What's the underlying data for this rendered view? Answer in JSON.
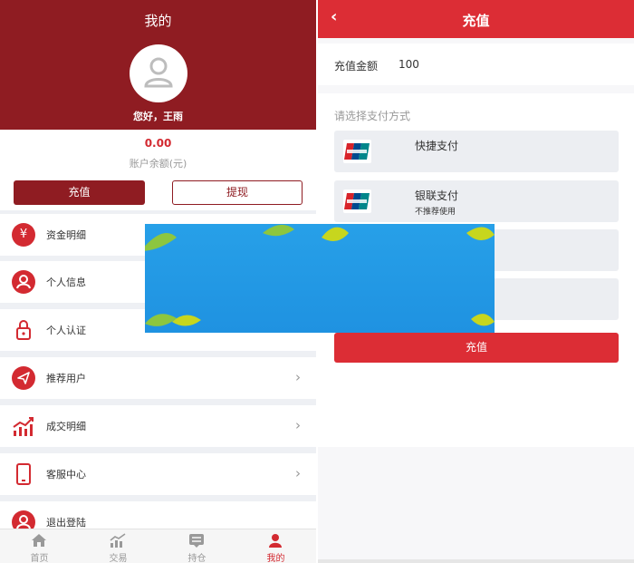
{
  "left": {
    "title": "我的",
    "greeting": "您好，王雨",
    "balance": {
      "value": "0.00",
      "label": "账户余额(元)"
    },
    "buttons": {
      "recharge": "充值",
      "withdraw": "提现"
    },
    "menu": [
      {
        "label": "资金明细",
        "icon": "yen-icon"
      },
      {
        "label": "个人信息",
        "icon": "user-circle-icon"
      },
      {
        "label": "个人认证",
        "icon": "lock-icon"
      },
      {
        "label": "推荐用户",
        "icon": "send-icon"
      },
      {
        "label": "成交明细",
        "icon": "chart-icon"
      },
      {
        "label": "客服中心",
        "icon": "phone-icon"
      },
      {
        "label": "退出登陆",
        "icon": "user-circle-icon"
      }
    ],
    "tabs": [
      {
        "label": "首页",
        "icon": "home-icon"
      },
      {
        "label": "交易",
        "icon": "trade-chart-icon"
      },
      {
        "label": "持仓",
        "icon": "holdings-icon"
      },
      {
        "label": "我的",
        "icon": "profile-icon",
        "active": true
      }
    ],
    "colors": {
      "header": "#8f1c22",
      "accent": "#d32a31"
    }
  },
  "right": {
    "title": "充值",
    "amount": {
      "label": "充值金额",
      "value": "100"
    },
    "pay_heading": "请选择支付方式",
    "pay_methods": [
      {
        "name": "快捷支付",
        "sub": "",
        "icon": "unionpay-icon"
      },
      {
        "name": "银联支付",
        "sub": "不推荐使用",
        "icon": "unionpay-icon"
      }
    ],
    "submit": "充值",
    "colors": {
      "header": "#dc2d35"
    }
  }
}
